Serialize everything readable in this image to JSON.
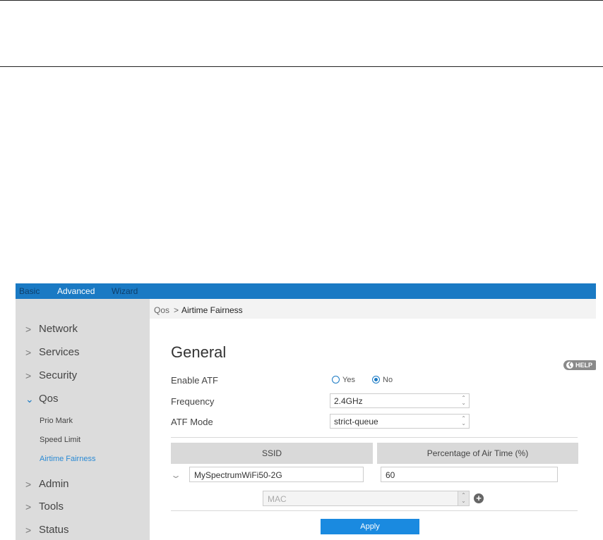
{
  "top_nav": {
    "basic": "Basic",
    "advanced": "Advanced",
    "wizard": "Wizard"
  },
  "sidebar": {
    "items": [
      {
        "label": "Network",
        "icon": "chevron-right-icon"
      },
      {
        "label": "Services",
        "icon": "chevron-right-icon"
      },
      {
        "label": "Security",
        "icon": "chevron-right-icon"
      },
      {
        "label": "Qos",
        "icon": "chevron-down-icon"
      },
      {
        "label": "Admin",
        "icon": "chevron-right-icon"
      },
      {
        "label": "Tools",
        "icon": "chevron-right-icon"
      },
      {
        "label": "Status",
        "icon": "chevron-right-icon"
      }
    ],
    "qos_subitems": [
      {
        "label": "Prio Mark"
      },
      {
        "label": "Speed Limit"
      },
      {
        "label": "Airtime Fairness",
        "active": true
      }
    ]
  },
  "breadcrumb": {
    "parent": "Qos",
    "separator": ">",
    "current": "Airtime Fairness"
  },
  "main": {
    "title": "General",
    "help_label": "HELP",
    "enable_atf": {
      "label": "Enable ATF",
      "options": [
        "Yes",
        "No"
      ],
      "selected": "No"
    },
    "frequency": {
      "label": "Frequency",
      "value": "2.4GHz"
    },
    "atf_mode": {
      "label": "ATF Mode",
      "value": "strict-queue"
    },
    "table": {
      "headers": [
        "SSID",
        "Percentage of Air Time (%)"
      ],
      "rows": [
        {
          "ssid": "MySpectrumWiFi50-2G",
          "percentage": "60"
        }
      ]
    },
    "mac_placeholder": "MAC",
    "apply_label": "Apply"
  },
  "colors": {
    "accent": "#1a7ac4",
    "sidebar_bg": "#dcdcdc",
    "button": "#1a8ae0"
  }
}
